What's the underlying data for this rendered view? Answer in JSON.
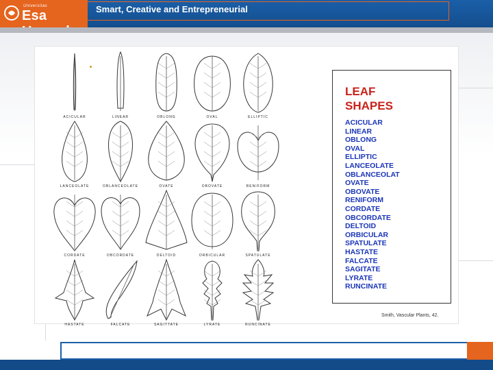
{
  "header": {
    "logo_small": "Universitas",
    "logo_text": "Esa Unggul",
    "tagline": "Smart, Creative and Entrepreneurial"
  },
  "figure": {
    "leaves": [
      {
        "label": "ACICULAR",
        "shape": "acicular"
      },
      {
        "label": "LINEAR",
        "shape": "linear"
      },
      {
        "label": "OBLONG",
        "shape": "oblong"
      },
      {
        "label": "OVAL",
        "shape": "oval"
      },
      {
        "label": "ELLIPTIC",
        "shape": "elliptic"
      },
      {
        "label": "LANCEOLATE",
        "shape": "lanceolate"
      },
      {
        "label": "OBLANCEOLATE",
        "shape": "oblanceolate"
      },
      {
        "label": "OVATE",
        "shape": "ovate"
      },
      {
        "label": "OBOVATE",
        "shape": "obovate"
      },
      {
        "label": "RENIFORM",
        "shape": "reniform"
      },
      {
        "label": "CORDATE",
        "shape": "cordate"
      },
      {
        "label": "OBCORDATE",
        "shape": "obcordate"
      },
      {
        "label": "DELTOID",
        "shape": "deltoid"
      },
      {
        "label": "ORBICULAR",
        "shape": "orbicular"
      },
      {
        "label": "SPATULATE",
        "shape": "spatulate"
      },
      {
        "label": "HASTATE",
        "shape": "hastate"
      },
      {
        "label": "FALCATE",
        "shape": "falcate"
      },
      {
        "label": "SAGITTATE",
        "shape": "sagittate"
      },
      {
        "label": "LYRATE",
        "shape": "lyrate"
      },
      {
        "label": "RUNCINATE",
        "shape": "runcinate"
      }
    ],
    "legend_title_line1": "LEAF",
    "legend_title_line2": "SHAPES",
    "legend_items": [
      "ACICULAR",
      "LINEAR",
      "OBLONG",
      "OVAL",
      "ELLIPTIC",
      "LANCEOLATE",
      "OBLANCEOLAT",
      "OVATE",
      "OBOVATE",
      "RENIFORM",
      "CORDATE",
      "OBCORDATE",
      "DELTOID",
      "ORBICULAR",
      "SPATULATE",
      "HASTATE",
      "FALCATE",
      "SAGITATE",
      "LYRATE",
      "RUNCINATE"
    ],
    "credit": "Smith, Vascular Plants, 42.",
    "colors": {
      "title": "#c8221a",
      "list": "#1a35b8"
    }
  }
}
